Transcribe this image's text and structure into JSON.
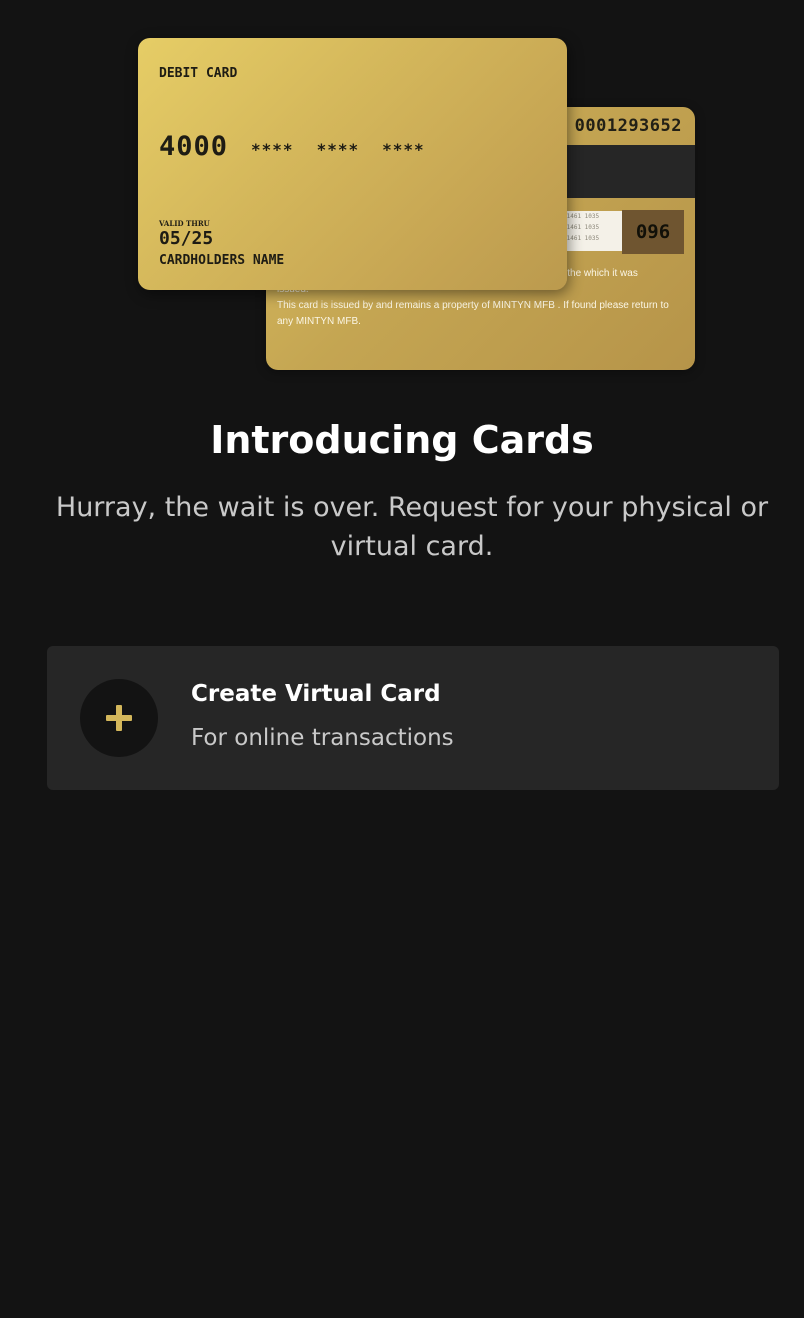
{
  "card_illustration": {
    "front": {
      "card_type": "DEBIT CARD",
      "number_first_group": "4000",
      "number_masked_groups": [
        "****",
        "****",
        "****"
      ],
      "valid_thru_label": "VALID THRU",
      "valid_thru_date": "05/25",
      "cardholder_name": "CARDHOLDERS NAME"
    },
    "back": {
      "card_number": "0001293652",
      "signature_lines": [
        "91461 1035",
        "91461 1035",
        "91461 1035"
      ],
      "cvv": "096",
      "notice_line_1_end": "der the which it was",
      "notice_line_1_cont": "issued.",
      "notice_line_2": "This card is issued by and remains a property of MINTYN MFB . If found please return to any MINTYN MFB."
    }
  },
  "intro": {
    "title": "Introducing Cards",
    "subtitle": "Hurray, the wait is over. Request for your physical or virtual card."
  },
  "actions": {
    "create_virtual_card": {
      "icon": "plus-icon",
      "title": "Create Virtual Card",
      "subtitle": "For online transactions"
    }
  },
  "colors": {
    "background": "#131313",
    "surface": "#262626",
    "accent_gold": "#d4b75b",
    "text_primary": "#ffffff",
    "text_secondary": "#c9c9c9"
  }
}
